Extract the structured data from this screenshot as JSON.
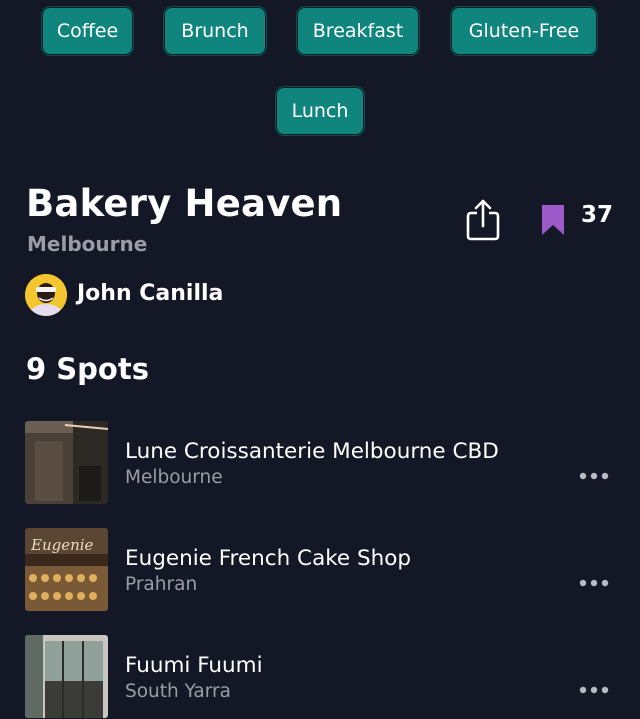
{
  "tags": [
    "Coffee",
    "Brunch",
    "Breakfast",
    "Gluten-Free",
    "Lunch"
  ],
  "list": {
    "title": "Bakery Heaven",
    "city": "Melbourne",
    "save_count": "37",
    "author": "John Canilla",
    "spots_heading": "9 Spots"
  },
  "spots": [
    {
      "name": "Lune Croissanterie Melbourne CBD",
      "location": "Melbourne"
    },
    {
      "name": "Eugenie French Cake Shop",
      "location": "Prahran"
    },
    {
      "name": "Fuumi Fuumi",
      "location": "South Yarra"
    }
  ],
  "colors": {
    "background": "#141726",
    "tag": "#0f857d",
    "bookmark": "#9b59c9",
    "muted_text": "#9a9ca6"
  },
  "icons": {
    "share": "share-icon",
    "bookmark": "bookmark-icon",
    "more": "more-options-icon"
  }
}
